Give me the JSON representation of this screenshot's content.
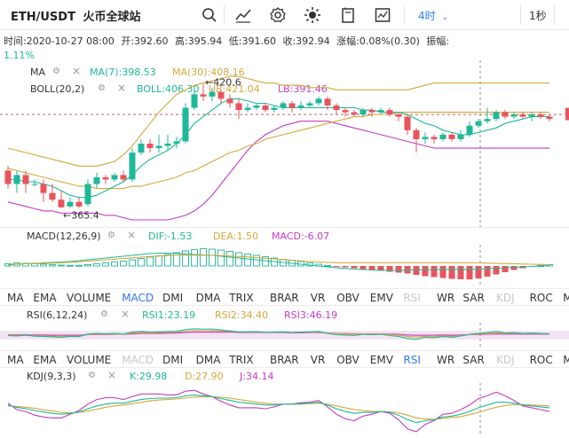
{
  "header": {
    "symbol": "ETH/USDT",
    "exchange": "火币全球站",
    "interval": "4时",
    "speed": "1秒",
    "icons": [
      "search-icon",
      "indicator-icon",
      "settings-icon",
      "theme-icon",
      "copy-icon",
      "screenshot-icon"
    ]
  },
  "info": {
    "time": "时间:2020-10-27 08:00",
    "open": "开:392.60",
    "high": "高:395.94",
    "low": "低:391.60",
    "close": "收:392.94",
    "change": "涨幅:0.08%(0.30)",
    "amplitude_label": "振幅:",
    "amplitude_value": "1.11%"
  },
  "ma": {
    "label": "MA",
    "ma7": "MA(7):398.53",
    "ma30": "MA(30):408.16"
  },
  "boll": {
    "label": "BOLL(20,2)",
    "boll": "BOLL:406.30",
    "ub": "UB:421.04",
    "lb": "LB:391.46"
  },
  "annotations": {
    "high": "420.6",
    "low": "365.4"
  },
  "macd": {
    "label": "MACD(12,26,9)",
    "dif": "DIF:-1.53",
    "dea": "DEA:1.50",
    "macd": "MACD:-6.07"
  },
  "rsi": {
    "label": "RSI(6,12,24)",
    "rsi1": "RSI1:23.19",
    "rsi2": "RSI2:34.40",
    "rsi3": "RSI3:46.19"
  },
  "kdj": {
    "label": "KDJ(9,3,3)",
    "k": "K:29.98",
    "d": "D:27.90",
    "j": "J:34.14"
  },
  "indicator_tabs": [
    "MA",
    "EMA",
    "VOLUME",
    "MACD",
    "DMI",
    "DMA",
    "TRIX",
    "BRAR",
    "VR",
    "OBV",
    "EMV",
    "RSI",
    "WR",
    "SAR",
    "KDJ",
    "ROC",
    "MTM"
  ],
  "tabs_row1_state": {
    "selected": "MACD",
    "dim": [
      "RSI",
      "KDJ"
    ]
  },
  "tabs_row2_state": {
    "selected": "RSI",
    "dim": [
      "MACD",
      "KDJ"
    ]
  },
  "colors": {
    "up": "#1fb89a",
    "down": "#e9545c",
    "ma7": "#1fb89a",
    "ma30": "#d4a73b",
    "boll": "#1fb89a",
    "ub": "#d4a73b",
    "lb": "#c43bc4",
    "accent": "#2e7ae6"
  },
  "chart_data": {
    "type": "candlestick",
    "candles": [
      {
        "o": 382,
        "c": 376,
        "h": 384,
        "l": 374
      },
      {
        "o": 376,
        "c": 380,
        "h": 382,
        "l": 372
      },
      {
        "o": 380,
        "c": 376,
        "h": 382,
        "l": 372
      },
      {
        "o": 376,
        "c": 376,
        "h": 378,
        "l": 375
      },
      {
        "o": 376,
        "c": 372,
        "h": 378,
        "l": 368
      },
      {
        "o": 372,
        "c": 369,
        "h": 376,
        "l": 368
      },
      {
        "o": 369,
        "c": 365.6,
        "h": 373,
        "l": 365.4
      },
      {
        "o": 366,
        "c": 368,
        "h": 370,
        "l": 365.4
      },
      {
        "o": 368,
        "c": 366,
        "h": 370,
        "l": 365.4
      },
      {
        "o": 367,
        "c": 376,
        "h": 378,
        "l": 366
      },
      {
        "o": 376,
        "c": 379,
        "h": 381,
        "l": 374
      },
      {
        "o": 379,
        "c": 378,
        "h": 380,
        "l": 376
      },
      {
        "o": 378,
        "c": 380,
        "h": 381,
        "l": 377
      },
      {
        "o": 380,
        "c": 378,
        "h": 382,
        "l": 377
      },
      {
        "o": 378,
        "c": 390,
        "h": 392,
        "l": 377
      },
      {
        "o": 390,
        "c": 394,
        "h": 396,
        "l": 389
      },
      {
        "o": 394,
        "c": 392,
        "h": 396,
        "l": 390
      },
      {
        "o": 392,
        "c": 393,
        "h": 398,
        "l": 390
      },
      {
        "o": 393,
        "c": 394,
        "h": 398,
        "l": 391
      },
      {
        "o": 394,
        "c": 395,
        "h": 397,
        "l": 392
      },
      {
        "o": 395,
        "c": 410,
        "h": 412,
        "l": 394
      },
      {
        "o": 410,
        "c": 416,
        "h": 418,
        "l": 409
      },
      {
        "o": 416,
        "c": 415,
        "h": 420.6,
        "l": 413
      },
      {
        "o": 415,
        "c": 417,
        "h": 419,
        "l": 413
      },
      {
        "o": 417,
        "c": 414,
        "h": 418,
        "l": 412
      },
      {
        "o": 414,
        "c": 412,
        "h": 416,
        "l": 410
      },
      {
        "o": 412,
        "c": 409,
        "h": 414,
        "l": 405
      },
      {
        "o": 409,
        "c": 410,
        "h": 412,
        "l": 408
      },
      {
        "o": 410,
        "c": 411,
        "h": 412,
        "l": 409
      },
      {
        "o": 411,
        "c": 409,
        "h": 412,
        "l": 408
      },
      {
        "o": 409,
        "c": 410,
        "h": 411,
        "l": 408
      },
      {
        "o": 410,
        "c": 412,
        "h": 413,
        "l": 409
      },
      {
        "o": 412,
        "c": 410,
        "h": 413,
        "l": 408
      },
      {
        "o": 410,
        "c": 411,
        "h": 413,
        "l": 409
      },
      {
        "o": 411,
        "c": 412,
        "h": 413,
        "l": 410
      },
      {
        "o": 412,
        "c": 414,
        "h": 415,
        "l": 411
      },
      {
        "o": 414,
        "c": 411,
        "h": 415,
        "l": 409
      },
      {
        "o": 411,
        "c": 409,
        "h": 412,
        "l": 407
      },
      {
        "o": 409,
        "c": 408,
        "h": 410,
        "l": 406
      },
      {
        "o": 408,
        "c": 407,
        "h": 409,
        "l": 406
      },
      {
        "o": 407,
        "c": 409,
        "h": 410,
        "l": 406
      },
      {
        "o": 409,
        "c": 408,
        "h": 410,
        "l": 406
      },
      {
        "o": 408,
        "c": 409,
        "h": 410,
        "l": 407
      },
      {
        "o": 409,
        "c": 407,
        "h": 410,
        "l": 406
      },
      {
        "o": 407,
        "c": 406,
        "h": 408,
        "l": 404
      },
      {
        "o": 406,
        "c": 400,
        "h": 407,
        "l": 398
      },
      {
        "o": 400,
        "c": 396,
        "h": 401,
        "l": 390
      },
      {
        "o": 396,
        "c": 397,
        "h": 399,
        "l": 394
      },
      {
        "o": 397,
        "c": 396,
        "h": 398,
        "l": 394
      },
      {
        "o": 396,
        "c": 398,
        "h": 399,
        "l": 395
      },
      {
        "o": 398,
        "c": 396,
        "h": 399,
        "l": 395
      },
      {
        "o": 396,
        "c": 398,
        "h": 400,
        "l": 395
      },
      {
        "o": 398,
        "c": 402,
        "h": 404,
        "l": 397
      },
      {
        "o": 402,
        "c": 404,
        "h": 405,
        "l": 401
      },
      {
        "o": 404,
        "c": 405,
        "h": 410,
        "l": 403
      },
      {
        "o": 405,
        "c": 408,
        "h": 409,
        "l": 404
      },
      {
        "o": 408,
        "c": 406,
        "h": 409,
        "l": 405
      },
      {
        "o": 406,
        "c": 407,
        "h": 408,
        "l": 405
      },
      {
        "o": 407,
        "c": 406,
        "h": 408,
        "l": 405
      },
      {
        "o": 406,
        "c": 407,
        "h": 408,
        "l": 404
      },
      {
        "o": 407,
        "c": 406,
        "h": 408,
        "l": 405
      },
      {
        "o": 406,
        "c": 405,
        "h": 407,
        "l": 404
      }
    ],
    "ma7": [
      378,
      378,
      377,
      377,
      376,
      375,
      373,
      371,
      370,
      370,
      371,
      373,
      375,
      377,
      380,
      384,
      387,
      389,
      391,
      394,
      398,
      403,
      406,
      409,
      412,
      414,
      414,
      413,
      412,
      412,
      411,
      410,
      410,
      410,
      410,
      410,
      410,
      410,
      410,
      410,
      409,
      409,
      408,
      408,
      408,
      407,
      405,
      403,
      402,
      400,
      399,
      398,
      398,
      399,
      400,
      401,
      403,
      404,
      405,
      406,
      406,
      406
    ],
    "ma30": [
      383,
      382,
      381,
      380,
      379,
      378,
      377,
      376,
      375,
      375,
      374,
      374,
      374,
      374,
      375,
      375,
      376,
      377,
      378,
      379,
      381,
      382,
      384,
      386,
      388,
      390,
      391,
      393,
      394,
      396,
      397,
      398,
      399,
      400,
      401,
      402,
      403,
      404,
      405,
      406,
      406,
      407,
      407,
      407,
      408,
      408,
      408,
      408,
      408,
      408,
      408,
      408,
      408,
      408,
      408,
      408,
      408,
      408,
      408,
      408,
      408,
      408
    ],
    "ub": [
      392,
      391,
      390,
      389,
      388,
      387,
      386,
      385,
      384,
      384,
      384,
      385,
      386,
      389,
      393,
      398,
      403,
      408,
      412,
      416,
      418,
      420,
      421,
      422,
      423,
      424,
      424,
      423,
      422,
      421,
      421,
      420,
      420,
      420,
      419,
      419,
      419,
      418,
      418,
      418,
      418,
      418,
      418,
      418,
      418,
      418,
      419,
      420,
      421,
      421,
      421,
      421,
      421,
      421,
      421,
      421,
      421,
      421,
      421,
      421,
      421,
      421
    ],
    "lb": [
      368,
      367,
      366,
      365,
      364,
      364,
      363,
      363,
      363,
      363,
      363,
      362,
      362,
      361,
      360,
      360,
      360,
      360,
      360,
      361,
      362,
      364,
      367,
      371,
      376,
      381,
      386,
      391,
      395,
      398,
      400,
      402,
      403,
      404,
      404,
      404,
      404,
      403,
      402,
      401,
      400,
      399,
      398,
      397,
      396,
      395,
      394,
      393,
      392,
      392,
      392,
      392,
      392,
      392,
      392,
      392,
      392,
      392,
      392,
      392,
      392,
      392
    ],
    "macd_hist": [
      1,
      1.5,
      1.2,
      1,
      0.8,
      0.6,
      0.4,
      0.3,
      0.3,
      0.6,
      1,
      1.4,
      1.8,
      2.2,
      2.8,
      3.4,
      4,
      4.6,
      5.2,
      6,
      6.8,
      7.4,
      7.8,
      7.6,
      7.2,
      6.6,
      6,
      5.4,
      4.8,
      4.2,
      3.6,
      3,
      2.6,
      2,
      1.4,
      0.8,
      0.2,
      -0.2,
      -0.6,
      -1,
      -1.4,
      -1.8,
      -2.2,
      -2.6,
      -3,
      -3.4,
      -4,
      -4.6,
      -5,
      -5.4,
      -5.8,
      -6,
      -6.07,
      -5.6,
      -4.8,
      -3.8,
      -2.8,
      -1.8,
      -1,
      -0.4,
      0.2,
      0.6
    ],
    "dif": [
      0.5,
      0.8,
      1,
      1.2,
      1.4,
      1.6,
      1.8,
      2,
      2.4,
      2.8,
      3.2,
      3.6,
      4,
      4.4,
      4.8,
      5.2,
      5.6,
      5.8,
      5.8,
      5.6,
      5.4,
      5.2,
      5,
      4.8,
      4.4,
      4,
      3.6,
      3.2,
      2.8,
      2.4,
      2,
      1.6,
      1.2,
      0.8,
      0.4,
      0,
      -0.4,
      -0.8,
      -1.1,
      -1.4,
      -1.6,
      -1.8,
      -1.9,
      -2,
      -2,
      -1.9,
      -1.8,
      -1.7,
      -1.6,
      -1.55,
      -1.5,
      -1.52,
      -1.53,
      -1.4,
      -1.2,
      -1,
      -0.8,
      -0.6,
      -0.4,
      -0.2,
      0,
      0.2
    ],
    "dea": [
      0.8,
      0.9,
      1,
      1.1,
      1.2,
      1.3,
      1.5,
      1.7,
      1.9,
      2.2,
      2.5,
      2.8,
      3.1,
      3.4,
      3.7,
      4,
      4.3,
      4.5,
      4.7,
      4.8,
      4.9,
      4.9,
      4.9,
      4.8,
      4.7,
      4.5,
      4.3,
      4.1,
      3.8,
      3.5,
      3.2,
      2.9,
      2.6,
      2.3,
      2,
      1.8,
      1.6,
      1.5,
      1.5,
      1.5,
      1.5,
      1.5,
      1.5,
      1.5,
      1.5,
      1.5,
      1.5,
      1.5,
      1.5,
      1.5,
      1.5,
      1.5,
      1.5,
      1.4,
      1.3,
      1.2,
      1.1,
      1,
      0.9,
      0.8,
      0.7,
      0.6
    ],
    "rsi1": [
      48,
      46,
      50,
      45,
      44,
      42,
      40,
      44,
      43,
      55,
      58,
      56,
      58,
      55,
      65,
      68,
      64,
      66,
      67,
      68,
      76,
      80,
      78,
      79,
      74,
      70,
      65,
      66,
      67,
      63,
      64,
      66,
      62,
      64,
      66,
      68,
      58,
      52,
      50,
      48,
      54,
      52,
      54,
      48,
      44,
      34,
      30,
      40,
      38,
      44,
      40,
      46,
      54,
      58,
      62,
      68,
      60,
      62,
      58,
      60,
      58,
      56
    ],
    "rsi2": [
      50,
      49,
      50,
      48,
      47,
      46,
      45,
      46,
      46,
      52,
      54,
      54,
      55,
      54,
      60,
      62,
      61,
      62,
      63,
      64,
      68,
      72,
      71,
      72,
      70,
      68,
      65,
      65,
      65,
      63,
      63,
      64,
      62,
      63,
      64,
      65,
      60,
      57,
      55,
      54,
      56,
      55,
      56,
      53,
      50,
      44,
      41,
      45,
      44,
      47,
      45,
      48,
      52,
      55,
      57,
      61,
      58,
      59,
      57,
      58,
      57,
      56
    ],
    "rsi3": [
      52,
      52,
      52,
      51,
      51,
      50,
      50,
      50,
      50,
      52,
      53,
      53,
      54,
      54,
      56,
      58,
      58,
      58,
      59,
      60,
      62,
      64,
      64,
      65,
      64,
      64,
      63,
      63,
      63,
      62,
      62,
      62,
      61,
      61,
      62,
      62,
      60,
      58,
      57,
      56,
      56,
      56,
      56,
      55,
      54,
      51,
      49,
      50,
      50,
      51,
      50,
      51,
      52,
      53,
      54,
      56,
      55,
      55,
      55,
      55,
      55,
      55
    ],
    "kdj_k": [
      60,
      55,
      52,
      48,
      45,
      42,
      40,
      42,
      45,
      52,
      58,
      62,
      64,
      64,
      68,
      72,
      74,
      75,
      75,
      76,
      80,
      82,
      80,
      78,
      74,
      70,
      66,
      64,
      62,
      60,
      60,
      62,
      62,
      63,
      64,
      66,
      60,
      52,
      46,
      42,
      44,
      44,
      46,
      44,
      38,
      28,
      22,
      26,
      28,
      34,
      36,
      40,
      46,
      54,
      60,
      66,
      66,
      64,
      60,
      58,
      56,
      54
    ],
    "kdj_d": [
      58,
      57,
      55,
      53,
      50,
      47,
      44,
      43,
      44,
      47,
      51,
      55,
      58,
      60,
      63,
      66,
      69,
      71,
      72,
      73,
      75,
      77,
      78,
      78,
      77,
      75,
      72,
      69,
      66,
      64,
      62,
      62,
      62,
      62,
      63,
      64,
      62,
      58,
      54,
      50,
      48,
      46,
      46,
      45,
      43,
      38,
      32,
      30,
      29,
      31,
      33,
      35,
      39,
      44,
      50,
      55,
      59,
      61,
      61,
      60,
      59,
      58
    ],
    "kdj_j": [
      64,
      50,
      46,
      38,
      34,
      32,
      32,
      40,
      48,
      62,
      72,
      76,
      76,
      72,
      78,
      84,
      84,
      84,
      82,
      82,
      90,
      92,
      84,
      78,
      68,
      60,
      54,
      54,
      54,
      52,
      56,
      62,
      62,
      65,
      66,
      70,
      56,
      40,
      30,
      26,
      36,
      40,
      46,
      42,
      28,
      8,
      2,
      18,
      26,
      40,
      42,
      50,
      60,
      74,
      80,
      88,
      80,
      70,
      58,
      54,
      50,
      46
    ]
  }
}
